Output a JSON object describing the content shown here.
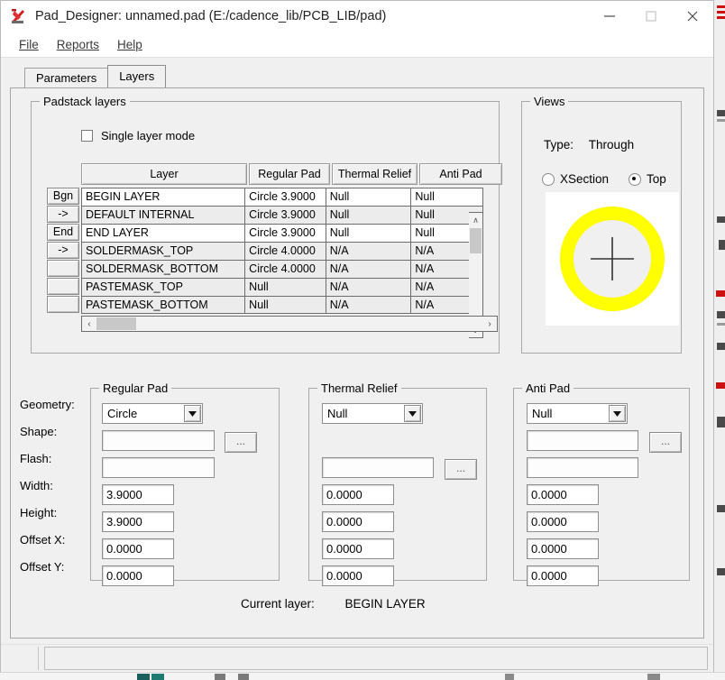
{
  "window": {
    "title": "Pad_Designer: unnamed.pad (E:/cadence_lib/PCB_LIB/pad)",
    "icon": "cadence-logo-icon",
    "minimize_label": "—",
    "maximize_label": "☐",
    "close_label": "✕"
  },
  "menubar": {
    "items": [
      {
        "label": "File",
        "mnemonic": "F"
      },
      {
        "label": "Reports",
        "mnemonic": "R"
      },
      {
        "label": "Help",
        "mnemonic": "H"
      }
    ]
  },
  "tabs": [
    {
      "label": "Parameters",
      "active": false
    },
    {
      "label": "Layers",
      "active": true
    }
  ],
  "padstack_layers": {
    "legend": "Padstack layers",
    "single_layer_mode": {
      "label": "Single layer mode",
      "checked": false
    },
    "columns": [
      "Layer",
      "Regular Pad",
      "Thermal Relief",
      "Anti Pad"
    ],
    "row_buttons": [
      "Bgn",
      "->",
      "End",
      "->",
      "",
      "",
      ""
    ],
    "rows": [
      {
        "layer": "BEGIN LAYER",
        "regular_pad": "Circle 3.9000",
        "thermal_relief": "Null",
        "anti_pad": "Null",
        "highlighted": true
      },
      {
        "layer": "DEFAULT INTERNAL",
        "regular_pad": "Circle 3.9000",
        "thermal_relief": "Null",
        "anti_pad": "Null",
        "highlighted": false
      },
      {
        "layer": "END LAYER",
        "regular_pad": "Circle 3.9000",
        "thermal_relief": "Null",
        "anti_pad": "Null",
        "highlighted": true
      },
      {
        "layer": "SOLDERMASK_TOP",
        "regular_pad": "Circle 4.0000",
        "thermal_relief": "N/A",
        "anti_pad": "N/A",
        "highlighted": false
      },
      {
        "layer": "SOLDERMASK_BOTTOM",
        "regular_pad": "Circle 4.0000",
        "thermal_relief": "N/A",
        "anti_pad": "N/A",
        "highlighted": false
      },
      {
        "layer": "PASTEMASK_TOP",
        "regular_pad": "Null",
        "thermal_relief": "N/A",
        "anti_pad": "N/A",
        "highlighted": false
      },
      {
        "layer": "PASTEMASK_BOTTOM",
        "regular_pad": "Null",
        "thermal_relief": "N/A",
        "anti_pad": "N/A",
        "highlighted": false
      }
    ],
    "scroll": {
      "up_glyph": "∧",
      "down_glyph": "∨",
      "left_glyph": "‹",
      "right_glyph": "›"
    }
  },
  "views": {
    "legend": "Views",
    "type_label": "Type:",
    "type_value": "Through",
    "radios": [
      {
        "label": "XSection",
        "selected": false
      },
      {
        "label": "Top",
        "selected": true
      }
    ],
    "preview": {
      "ring_color": "#FFFF00",
      "inner_color": "#f0f0f0",
      "crosshair_color": "#333333",
      "background": "#ffffff"
    }
  },
  "property_labels": [
    "Geometry:",
    "Shape:",
    "Flash:",
    "Width:",
    "Height:",
    "Offset X:",
    "Offset Y:"
  ],
  "regular_pad": {
    "legend": "Regular Pad",
    "geometry": "Circle",
    "shape": "",
    "flash": "",
    "width": "3.9000",
    "height": "3.9000",
    "offset_x": "0.0000",
    "offset_y": "0.0000",
    "browse_label": "..."
  },
  "thermal_relief": {
    "legend": "Thermal Relief",
    "geometry": "Null",
    "shape": "",
    "width": "0.0000",
    "height": "0.0000",
    "offset_x": "0.0000",
    "offset_y": "0.0000",
    "browse_label": "..."
  },
  "anti_pad": {
    "legend": "Anti Pad",
    "geometry": "Null",
    "shape": "",
    "flash": "",
    "width": "0.0000",
    "height": "0.0000",
    "offset_x": "0.0000",
    "offset_y": "0.0000",
    "browse_label": "..."
  },
  "status": {
    "current_layer_label": "Current layer:",
    "current_layer_value": "BEGIN LAYER"
  }
}
